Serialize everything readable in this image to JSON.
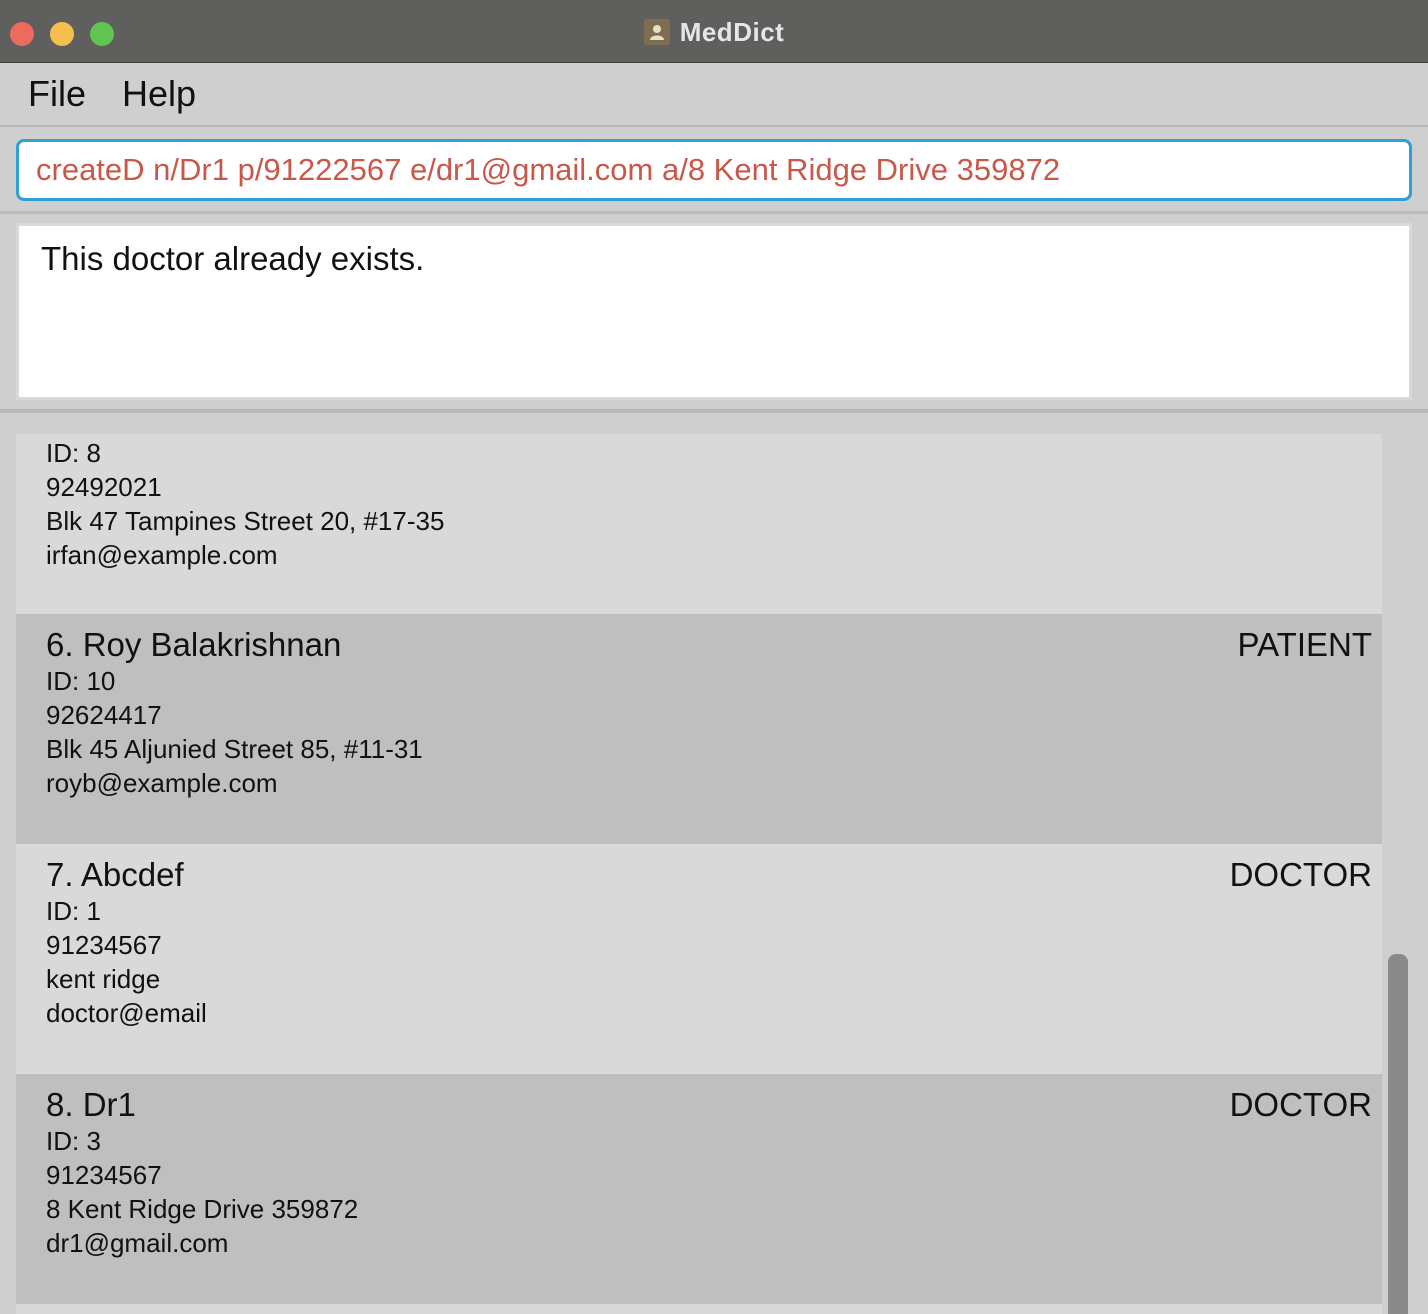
{
  "window": {
    "title": "MedDict"
  },
  "menu": {
    "file": "File",
    "help": "Help"
  },
  "command": {
    "value": "createD n/Dr1 p/91222567 e/dr1@gmail.com a/8 Kent Ridge Drive 359872"
  },
  "result": {
    "message": "This doctor already exists."
  },
  "persons": {
    "partial": {
      "id": "ID: 8",
      "phone": "92492021",
      "address": "Blk 47 Tampines Street 20, #17-35",
      "email": "irfan@example.com"
    },
    "items": [
      {
        "name": "6. Roy Balakrishnan",
        "role": "PATIENT",
        "id": "ID: 10",
        "phone": "92624417",
        "address": "Blk 45 Aljunied Street 85, #11-31",
        "email": "royb@example.com"
      },
      {
        "name": "7. Abcdef",
        "role": "DOCTOR",
        "id": "ID: 1",
        "phone": "91234567",
        "address": "kent ridge",
        "email": "doctor@email"
      },
      {
        "name": "8. Dr1",
        "role": "DOCTOR",
        "id": "ID: 3",
        "phone": "91234567",
        "address": "8 Kent Ridge Drive 359872",
        "email": "dr1@gmail.com"
      }
    ]
  }
}
